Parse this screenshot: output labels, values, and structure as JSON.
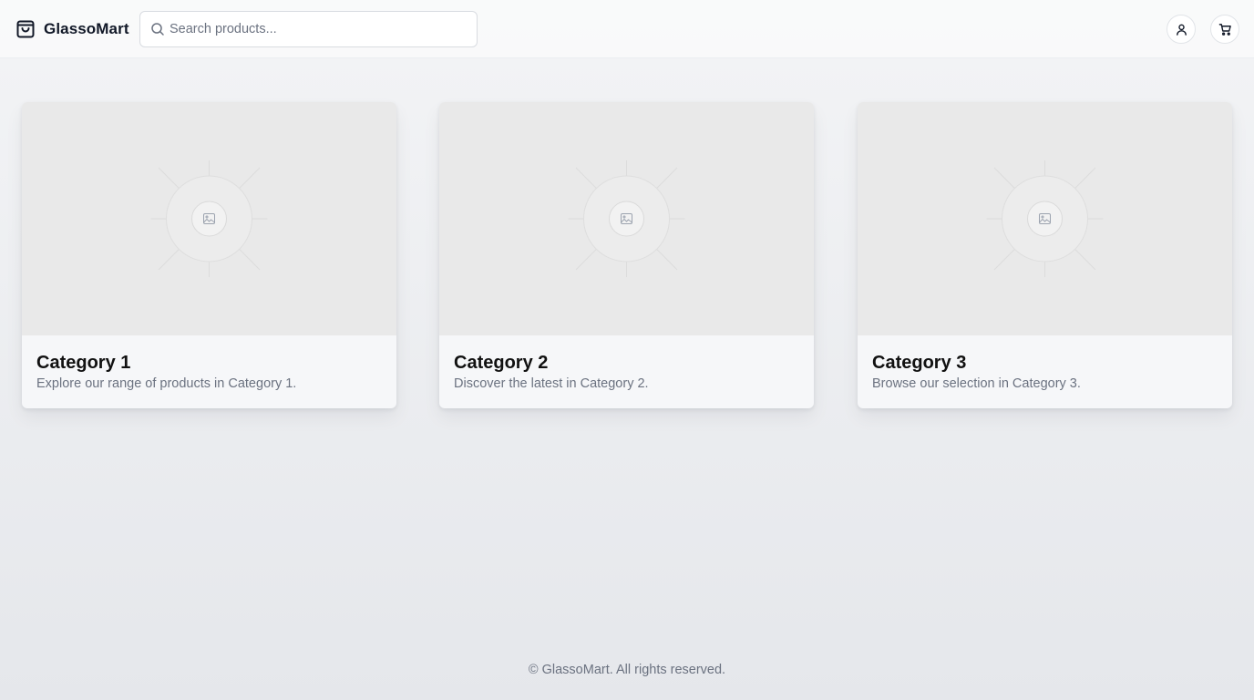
{
  "header": {
    "brand_name": "GlassoMart",
    "brand_icon": "shopping-bag-icon",
    "search": {
      "placeholder": "Search products...",
      "value": "",
      "icon": "search-icon"
    },
    "actions": [
      {
        "name": "account",
        "icon": "user-icon"
      },
      {
        "name": "cart",
        "icon": "shopping-cart-icon"
      }
    ]
  },
  "categories": [
    {
      "title": "Category 1",
      "description": "Explore our range of products in Category 1.",
      "image_icon": "image-placeholder-icon"
    },
    {
      "title": "Category 2",
      "description": "Discover the latest in Category 2.",
      "image_icon": "image-placeholder-icon"
    },
    {
      "title": "Category 3",
      "description": "Browse our selection in Category 3.",
      "image_icon": "image-placeholder-icon"
    }
  ],
  "footer": {
    "text": "© GlassoMart. All rights reserved."
  },
  "colors": {
    "text_primary": "#111827",
    "text_secondary": "#6b7280",
    "placeholder_bg": "#e9e9e9",
    "card_bg": "#f6f7f9"
  }
}
